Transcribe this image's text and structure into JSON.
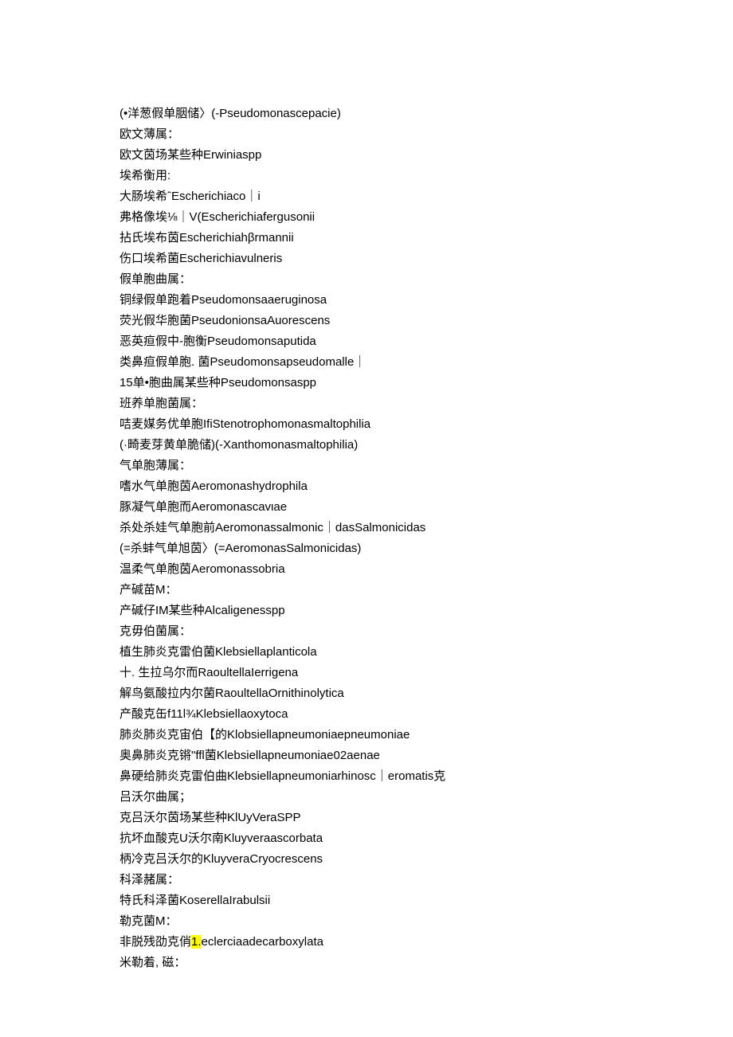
{
  "lines": [
    {
      "text": "(•洋葱假单胭储〉(-Pseudomonascepacie)",
      "highlight": null
    },
    {
      "text": "欧文薄属：",
      "highlight": null
    },
    {
      "text": "欧文茵场某些种Erwiniaspp",
      "highlight": null
    },
    {
      "text": "埃希衡用:",
      "highlight": null
    },
    {
      "text": "大肠埃希ˆEscherichiaco｜i",
      "highlight": null
    },
    {
      "text": "弗格像埃⅛｜V(Escherichiafergusonii",
      "highlight": null
    },
    {
      "text": "拈氏埃布茵Escherichiahβrmannii",
      "highlight": null
    },
    {
      "text": "伤口埃希菌Escherichiavulneris",
      "highlight": null
    },
    {
      "text": "假单胞曲属：",
      "highlight": null
    },
    {
      "text": "铜绿假单跑着Pseudomonsaaeruginosa",
      "highlight": null
    },
    {
      "text": "荧光假华胞菌PseudonionsaAuorescens",
      "highlight": null
    },
    {
      "text": "恶英疸假中-胞衡Pseudomonsaputida",
      "highlight": null
    },
    {
      "text": "类鼻疸假单胞. 菌Pseudomonsapseudomalle｜",
      "highlight": null
    },
    {
      "text": "15单•胞曲属某些种Pseudomonsaspp",
      "highlight": null
    },
    {
      "text": "班养单胞菌属：",
      "highlight": null
    },
    {
      "text": "咭麦媒务优单胞IfiStenotrophomonasmaltophilia",
      "highlight": null
    },
    {
      "text": "(·畸麦芽黄单脆储)(-Xanthomonasmaltophilia)",
      "highlight": null
    },
    {
      "text": "气单胞薄属：",
      "highlight": null
    },
    {
      "text": "嗜水气单胞茵Aeromonashydrophila",
      "highlight": null
    },
    {
      "text": "豚凝气单胞而Aeromonascavιae",
      "highlight": null
    },
    {
      "text": "杀处杀娃气单胞前Aeromonassalmonic｜dasSalmonicidas",
      "highlight": null
    },
    {
      "text": "(=杀蚌气单旭茵〉(=AeromonasSalmonicidas)",
      "highlight": null
    },
    {
      "text": "温柔气单胞茵Aeromonassobria",
      "highlight": null
    },
    {
      "text": "产碱苗M：",
      "highlight": null
    },
    {
      "text": "产碱仔IM某些种Alcaligenesspp",
      "highlight": null
    },
    {
      "text": "克毋伯菌属：",
      "highlight": null
    },
    {
      "text": "植生肺炎克雷伯菌Klebsiellaplanticola",
      "highlight": null
    },
    {
      "text": "十. 生拉乌尔而RaoultellaIerrigena",
      "highlight": null
    },
    {
      "text": "解鸟氨酸拉内尔菌RaoultellaOrnithinolytica",
      "highlight": null
    },
    {
      "text": "产酸克缶f11l¾Klebsiellaoxytoca",
      "highlight": null
    },
    {
      "text": "肺炎肺炎克宙伯【的Klobsiellapneumoniaepneumoniae",
      "highlight": null
    },
    {
      "text": "奥鼻肺炎克锵\"ffl菌Klebsiellapneumoniae02aenae",
      "highlight": null
    },
    {
      "text": "鼻硬给肺炎克雷伯曲Klebsiellapneumoniarhinosc｜eromatis克",
      "highlight": null
    },
    {
      "text": "吕沃尔曲属；",
      "highlight": null
    },
    {
      "text": "克吕沃尔茵场某些种KlUyVeraSPP",
      "highlight": null
    },
    {
      "text": "抗坏血酸克U沃尔南Kluyveraascorbata",
      "highlight": null
    },
    {
      "text": "柄冷克吕沃尔的KluyveraCryocrescens",
      "highlight": null
    },
    {
      "text": "科泽赭属：",
      "highlight": null
    },
    {
      "text": "特氏科泽菌KoserellaIrabulsii",
      "highlight": null
    },
    {
      "text": "勒克菌M：",
      "highlight": null
    },
    {
      "text": "非脱残劭克俏",
      "highlight": "1.",
      "suffix": "eclerciaadecarboxylata"
    },
    {
      "text": "米勒着, 磁：",
      "highlight": null
    }
  ]
}
